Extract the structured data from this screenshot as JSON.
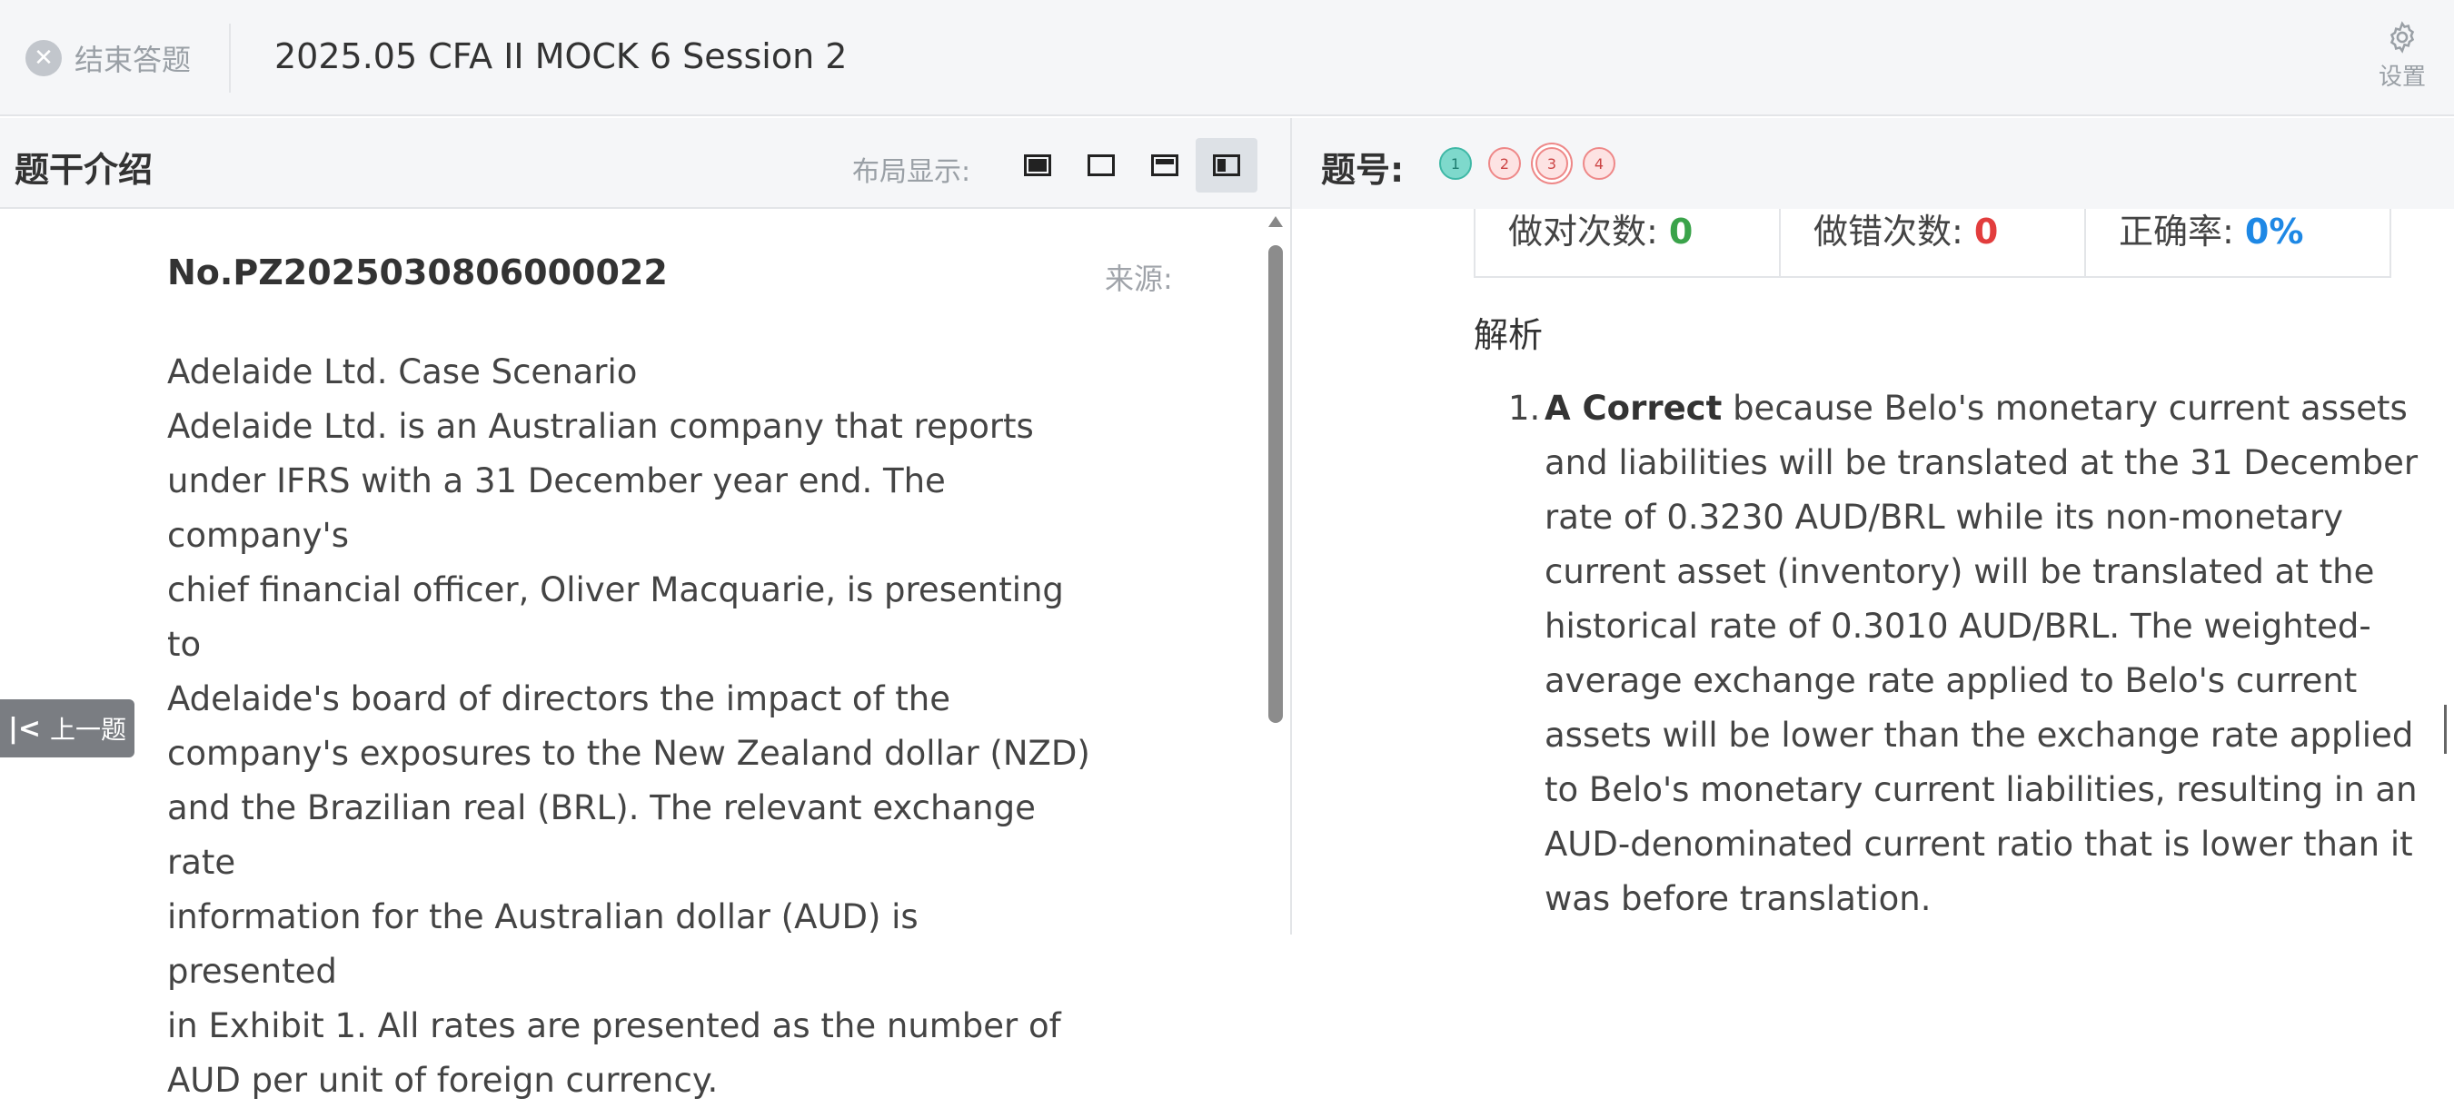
{
  "header": {
    "end_label": "结束答题",
    "title": "2025.05 CFA II MOCK 6 Session 2",
    "settings_label": "设置"
  },
  "left": {
    "title": "题干介绍",
    "layout_label": "布局显示:",
    "layout_icons": [
      "layout-fill-icon",
      "layout-empty-icon",
      "layout-top-icon",
      "layout-side-icon"
    ],
    "question_no": "No.PZ2025030806000022",
    "source_label": "来源:",
    "case_title": "Adelaide Ltd. Case Scenario",
    "body_lines": [
      "Adelaide Ltd. is an Australian company that reports",
      "under IFRS with a 31 December year end. The company's",
      "chief financial officer, Oliver Macquarie, is presenting to",
      "Adelaide's board of directors the impact of the",
      "company's exposures to the New Zealand dollar (NZD)",
      "and the Brazilian real (BRL). The relevant exchange rate",
      "information for the Australian dollar (AUD) is presented",
      "in Exhibit 1. All rates are presented as the number of",
      "AUD per unit of foreign currency."
    ],
    "prev_label": "上一题"
  },
  "right": {
    "qnum_label": "题号:",
    "questions": [
      {
        "n": "1",
        "status": "correct"
      },
      {
        "n": "2",
        "status": "wrong"
      },
      {
        "n": "3",
        "status": "wrong-current"
      },
      {
        "n": "4",
        "status": "wrong"
      }
    ],
    "stats": {
      "correct_label": "做对次数:",
      "correct_value": "0",
      "wrong_label": "做错次数:",
      "wrong_value": "0",
      "rate_label": "正确率:",
      "rate_value": "0%"
    },
    "analysis_title": "解析",
    "analysis_item": {
      "num": "1.",
      "bold": "A Correct",
      "lines": [
        " because Belo's monetary current assets",
        "and liabilities will be translated at the 31 December",
        "rate of 0.3230 AUD/BRL while its non-monetary",
        "current asset (inventory) will be translated at the",
        "historical rate of 0.3010 AUD/BRL. The weighted-",
        "average exchange rate applied to Belo's current",
        "assets will be lower than the exchange rate applied",
        "to Belo's monetary current liabilities, resulting in an",
        "AUD-denominated current ratio that is lower than it",
        "was before translation."
      ]
    }
  }
}
